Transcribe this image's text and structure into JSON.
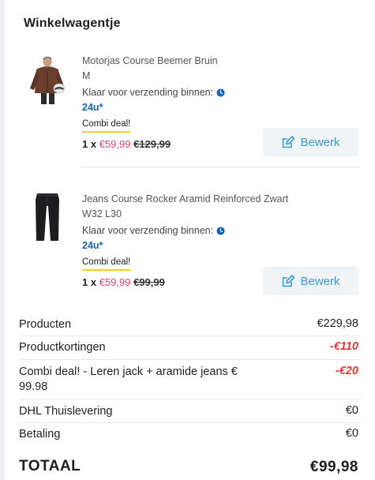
{
  "cart": {
    "title": "Winkelwagentje"
  },
  "items": [
    {
      "name": "Motorjas Course Beemer Bruin",
      "variant": "M",
      "ship_label": "Klaar voor verzending binnen:",
      "ship_time": "24u*",
      "deal": "Combi deal!",
      "qty": "1 x",
      "price_new": "€59,99",
      "price_old": "€129,99",
      "edit_label": "Bewerk"
    },
    {
      "name": "Jeans Course Rocker Aramid Reinforced Zwart",
      "variant": "W32 L30",
      "ship_label": "Klaar voor verzending binnen:",
      "ship_time": "24u*",
      "deal": "Combi deal!",
      "qty": "1 x",
      "price_new": "€59,99",
      "price_old": "€99,99",
      "edit_label": "Bewerk"
    }
  ],
  "summary": [
    {
      "label": "Producten",
      "value": "€229,98"
    },
    {
      "label": "Productkortingen",
      "value": "-€110"
    },
    {
      "label": "Combi deal! - Leren jack + aramide jeans € 99.98",
      "value": "-€20"
    },
    {
      "label": "DHL Thuislevering",
      "value": "€0"
    },
    {
      "label": "Betaling",
      "value": "€0"
    }
  ],
  "total": {
    "label": "TOTAAL",
    "value": "€99,98"
  },
  "colors": {
    "accent": "#3a9ad9",
    "sale": "#e0457b",
    "discount": "#e53935",
    "ship": "#1565c0",
    "deal_underline": "#f2d21b"
  }
}
